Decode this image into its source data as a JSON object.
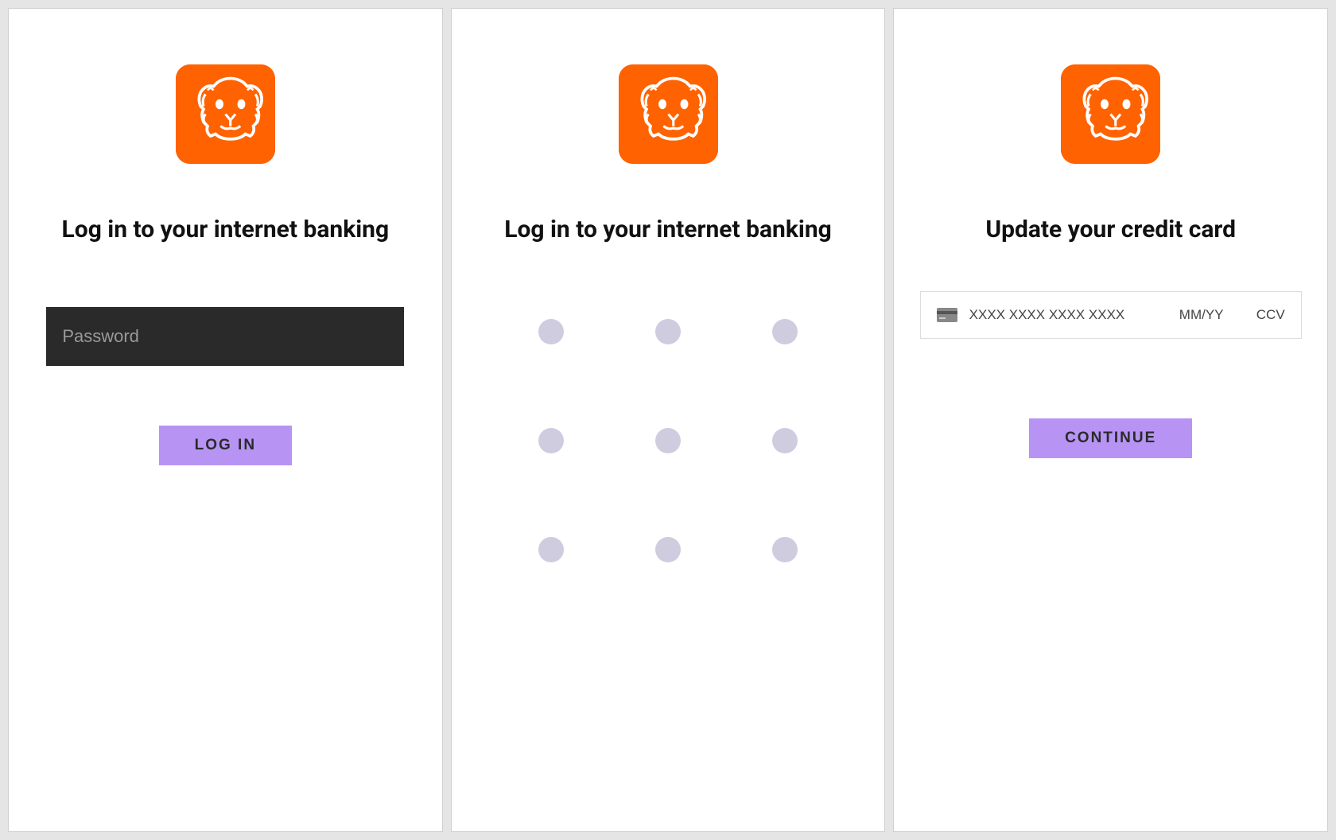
{
  "colors": {
    "brand_orange": "#ff6200",
    "button_purple": "#b794f4",
    "dot_grey": "#cfcce0",
    "input_dark": "#2a2a2a"
  },
  "panel1": {
    "title": "Log in to your internet banking",
    "password_placeholder": "Password",
    "login_button": "Log In"
  },
  "panel2": {
    "title": "Log in to your internet banking"
  },
  "panel3": {
    "title": "Update your credit card",
    "card_number_placeholder": "XXXX XXXX XXXX XXXX",
    "expiry_placeholder": "MM/YY",
    "cvv_placeholder": "CCV",
    "continue_button": "Continue"
  }
}
